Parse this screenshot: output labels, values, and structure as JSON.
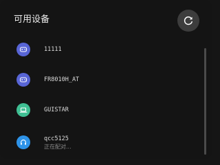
{
  "header": {
    "title": "可用设备",
    "refresh_icon": "refresh-icon"
  },
  "devices": [
    {
      "name": "11111",
      "icon": "gamepad-icon",
      "icon_color": "#5865d6",
      "status": ""
    },
    {
      "name": "FR8010H_AT",
      "icon": "gamepad-icon",
      "icon_color": "#5865d6",
      "status": ""
    },
    {
      "name": "GUISTAR",
      "icon": "laptop-icon",
      "icon_color": "#3fbf93",
      "status": ""
    },
    {
      "name": "qcc5125",
      "icon": "headphones-icon",
      "icon_color": "#2e93e8",
      "status": "正在配对..."
    }
  ],
  "colors": {
    "background": "#141414",
    "button_bg": "#3d3d3d",
    "gamepad": "#5865d6",
    "laptop": "#3fbf93",
    "headphones": "#2e93e8"
  }
}
